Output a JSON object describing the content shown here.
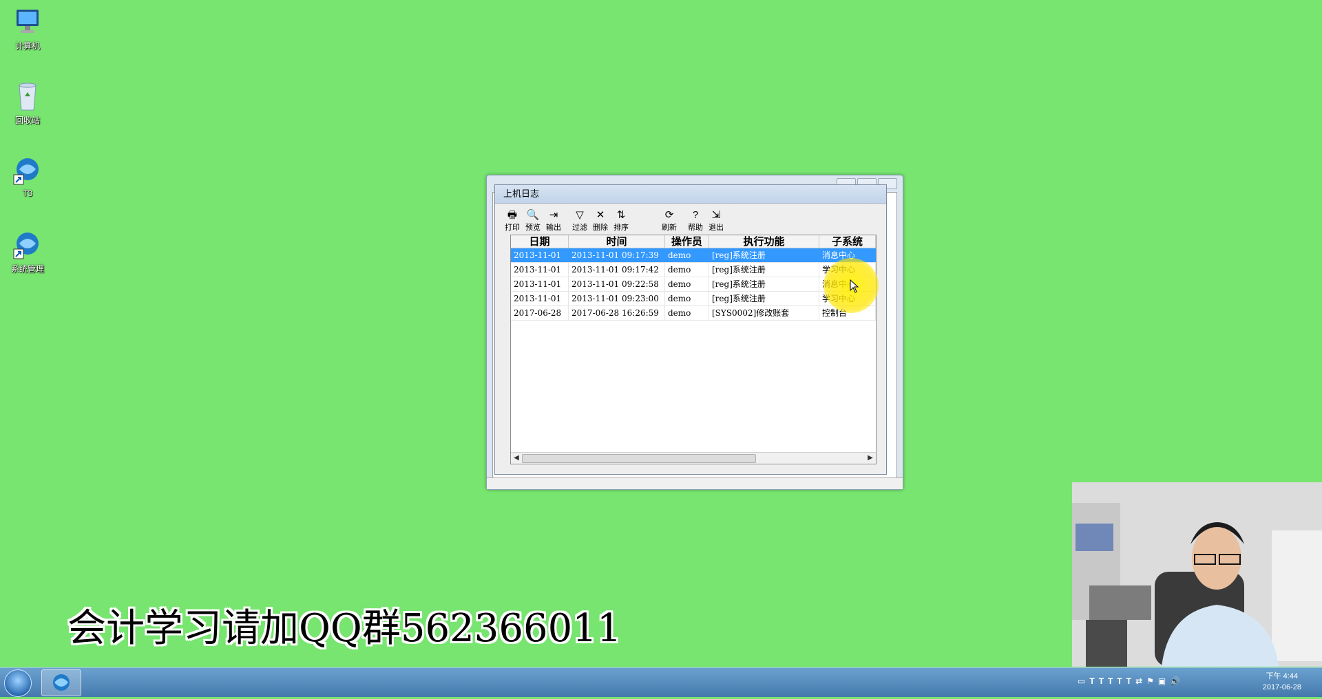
{
  "desktop": {
    "icons": [
      {
        "label": "计算机",
        "icon": "computer-icon"
      },
      {
        "label": "回收站",
        "icon": "recycle-bin-icon"
      },
      {
        "label": "T3",
        "icon": "t3-app-icon"
      },
      {
        "label": "系统管理",
        "icon": "system-manage-icon"
      }
    ]
  },
  "dialog": {
    "title": "上机日志",
    "toolbar": [
      {
        "label": "打印",
        "icon": "printer-icon"
      },
      {
        "label": "预览",
        "icon": "preview-icon"
      },
      {
        "label": "输出",
        "icon": "export-icon"
      },
      {
        "label": "过滤",
        "icon": "filter-icon"
      },
      {
        "label": "删除",
        "icon": "delete-icon"
      },
      {
        "label": "排序",
        "icon": "sort-icon"
      },
      {
        "label": "刷新",
        "icon": "refresh-icon"
      },
      {
        "label": "帮助",
        "icon": "help-icon"
      },
      {
        "label": "退出",
        "icon": "exit-icon"
      }
    ],
    "columns": [
      "日期",
      "时间",
      "操作员",
      "执行功能",
      "子系统"
    ],
    "rows": [
      [
        "2013-11-01",
        "2013-11-01 09:17:39",
        "demo",
        "[reg]系统注册",
        "消息中心"
      ],
      [
        "2013-11-01",
        "2013-11-01 09:17:42",
        "demo",
        "[reg]系统注册",
        "学习中心"
      ],
      [
        "2013-11-01",
        "2013-11-01 09:22:58",
        "demo",
        "[reg]系统注册",
        "消息中心"
      ],
      [
        "2013-11-01",
        "2013-11-01 09:23:00",
        "demo",
        "[reg]系统注册",
        "学习中心"
      ],
      [
        "2017-06-28",
        "2017-06-28 16:26:59",
        "demo",
        "[SYS0002]修改账套",
        "控制台"
      ]
    ],
    "selected_row": 0
  },
  "caption": "会计学习请加QQ群562366011",
  "taskbar": {
    "clock_time": "下午 4:44",
    "clock_date": "2017-06-28"
  },
  "colors": {
    "desktop_bg": "#77e56f",
    "selection": "#3399ff"
  }
}
